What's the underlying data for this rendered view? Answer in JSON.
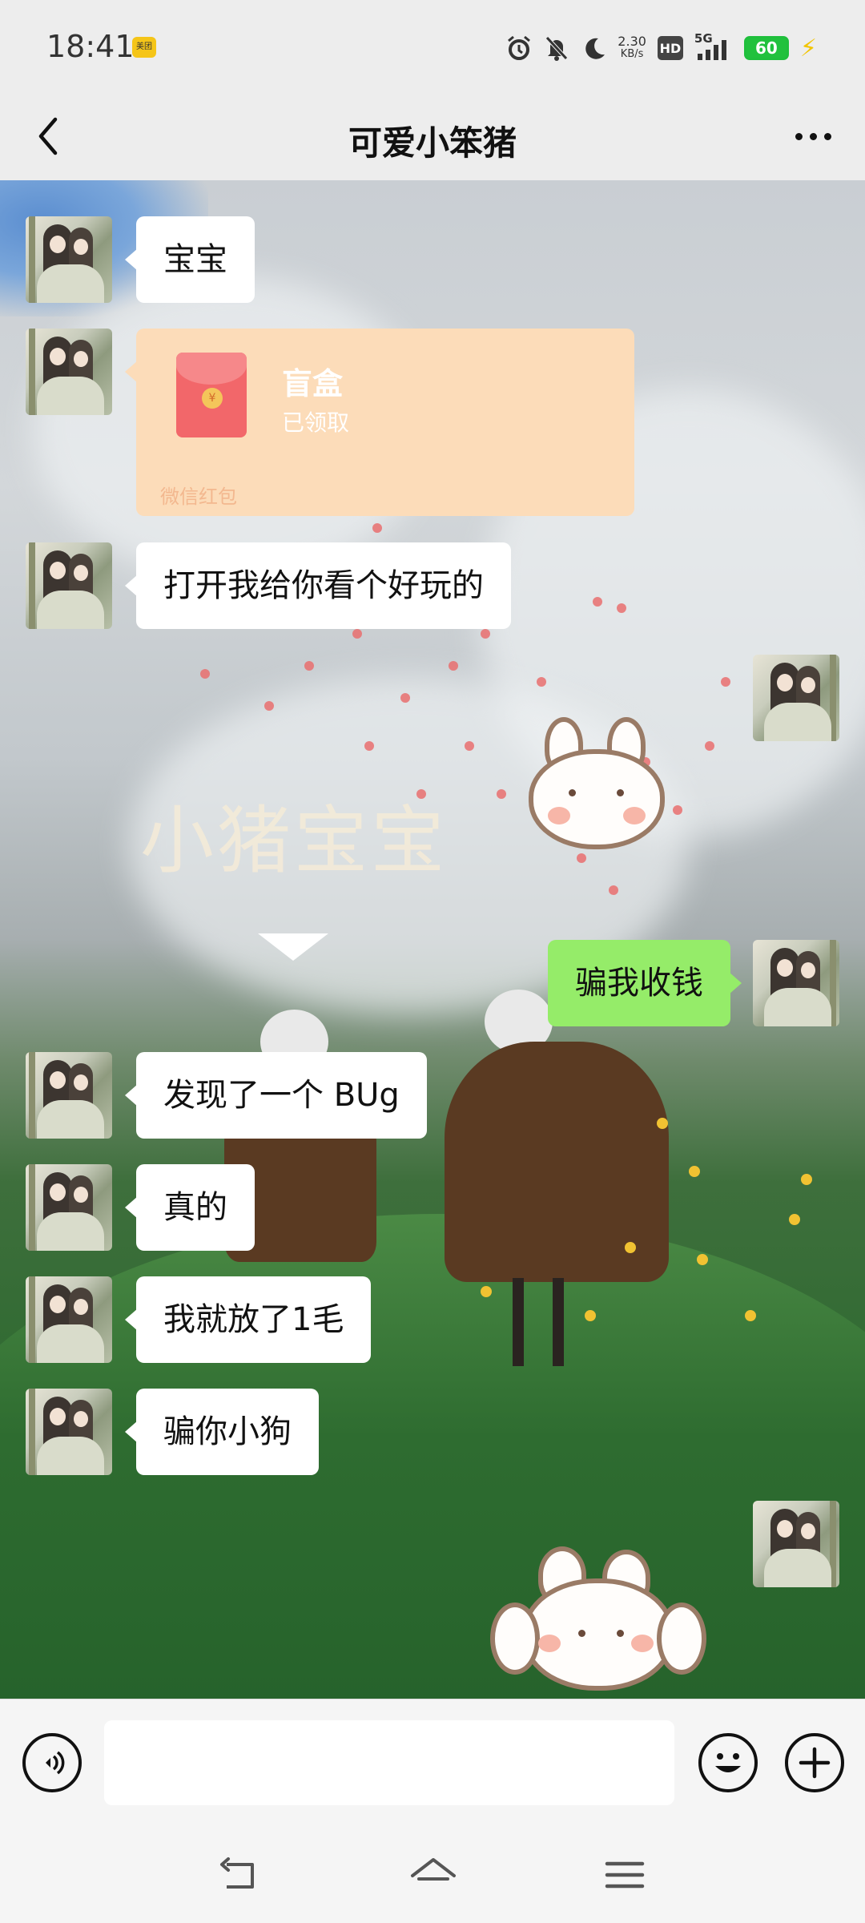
{
  "status_bar": {
    "time": "18:41",
    "app_badge": "美团",
    "net_speed_value": "2.30",
    "net_speed_unit": "KB/s",
    "hd": "HD",
    "network": "5G",
    "battery": "60"
  },
  "header": {
    "title": "可爱小笨猪"
  },
  "background": {
    "overlay_text": "小猪宝宝"
  },
  "messages": [
    {
      "side": "left",
      "type": "text",
      "text": "宝宝"
    },
    {
      "side": "left",
      "type": "red_packet",
      "title": "盲盒",
      "status": "已领取",
      "footer": "微信红包"
    },
    {
      "side": "left",
      "type": "text",
      "text": "打开我给你看个好玩的"
    },
    {
      "side": "right",
      "type": "sticker",
      "sticker": "bunny-pouting"
    },
    {
      "side": "right",
      "type": "text",
      "text": "骗我收钱"
    },
    {
      "side": "left",
      "type": "text",
      "text": "发现了一个 BUg"
    },
    {
      "side": "left",
      "type": "text",
      "text": "真的"
    },
    {
      "side": "left",
      "type": "text",
      "text": "我就放了1毛"
    },
    {
      "side": "left",
      "type": "text",
      "text": "骗你小狗"
    },
    {
      "side": "right",
      "type": "sticker",
      "sticker": "bunny-covering-ears"
    }
  ],
  "input_bar": {
    "voice_icon": "voice-icon",
    "emoji_icon": "emoji-icon",
    "plus_icon": "plus-icon",
    "placeholder": ""
  },
  "colors": {
    "self_bubble": "#95ec69",
    "other_bubble": "#ffffff",
    "red_packet": "#fcdcb9",
    "battery": "#21c13d"
  }
}
